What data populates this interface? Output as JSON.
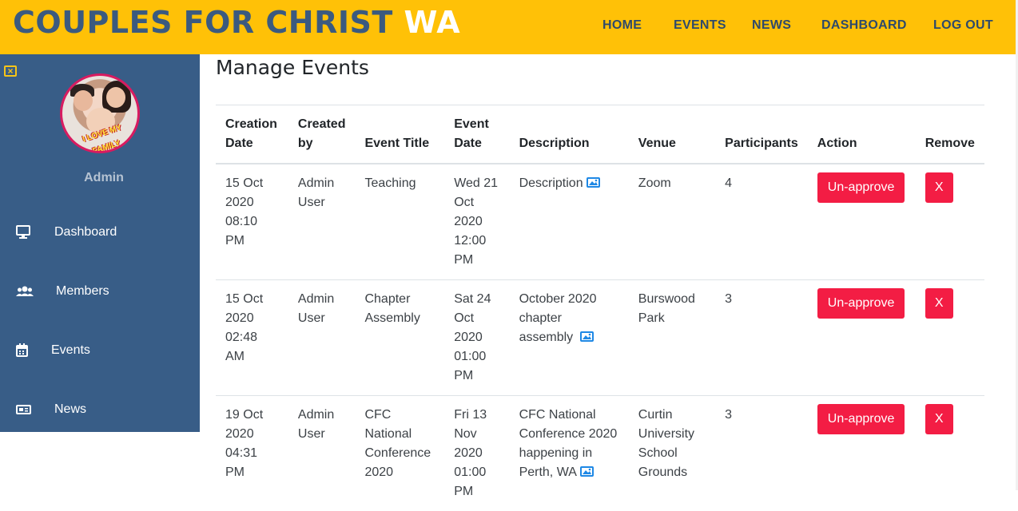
{
  "header": {
    "brand_main": "COUPLES FOR CHRIST",
    "brand_accent": "WA",
    "nav": [
      {
        "label": "HOME"
      },
      {
        "label": "EVENTS"
      },
      {
        "label": "NEWS"
      },
      {
        "label": "DASHBOARD"
      },
      {
        "label": "LOG OUT"
      }
    ]
  },
  "sidebar": {
    "close_icon": "close-icon",
    "avatar_text": "I LOVE MY FAMILY",
    "user_label": "Admin",
    "items": [
      {
        "label": "Dashboard",
        "icon": "monitor-icon"
      },
      {
        "label": "Members",
        "icon": "users-icon"
      },
      {
        "label": "Events",
        "icon": "calendar-icon"
      },
      {
        "label": "News",
        "icon": "newspaper-icon"
      }
    ]
  },
  "main": {
    "title": "Manage Events",
    "columns": [
      "Creation Date",
      "Created by",
      "Event Title",
      "Event Date",
      "Description",
      "Venue",
      "Participants",
      "Action",
      "Remove"
    ],
    "rows": [
      {
        "creation_date": "15 Oct 2020 08:10 PM",
        "created_by": "Admin User",
        "event_title": "Teaching",
        "event_date": "Wed 21 Oct 2020 12:00 PM",
        "description": "Description",
        "venue": "Zoom",
        "participants": "4",
        "action": "Un-approve",
        "remove": "X"
      },
      {
        "creation_date": "15 Oct 2020 02:48 AM",
        "created_by": "Admin User",
        "event_title": "Chapter Assembly",
        "event_date": "Sat 24 Oct 2020 01:00 PM",
        "description": "October 2020 chapter assembly",
        "venue": "Burswood Park",
        "participants": "3",
        "action": "Un-approve",
        "remove": "X"
      },
      {
        "creation_date": "19 Oct 2020 04:31 PM",
        "created_by": "Admin User",
        "event_title": "CFC National Conference 2020",
        "event_date": "Fri 13 Nov 2020 01:00 PM",
        "description": "CFC National Conference 2020 happening in Perth, WA",
        "venue": "Curtin University School Grounds",
        "participants": "3",
        "action": "Un-approve",
        "remove": "X"
      }
    ]
  },
  "colors": {
    "header_bg": "#ffc107",
    "brand_blue": "#3b5a7f",
    "sidebar_bg": "#385d87",
    "danger": "#f31d44",
    "image_icon": "#1e88e5"
  }
}
